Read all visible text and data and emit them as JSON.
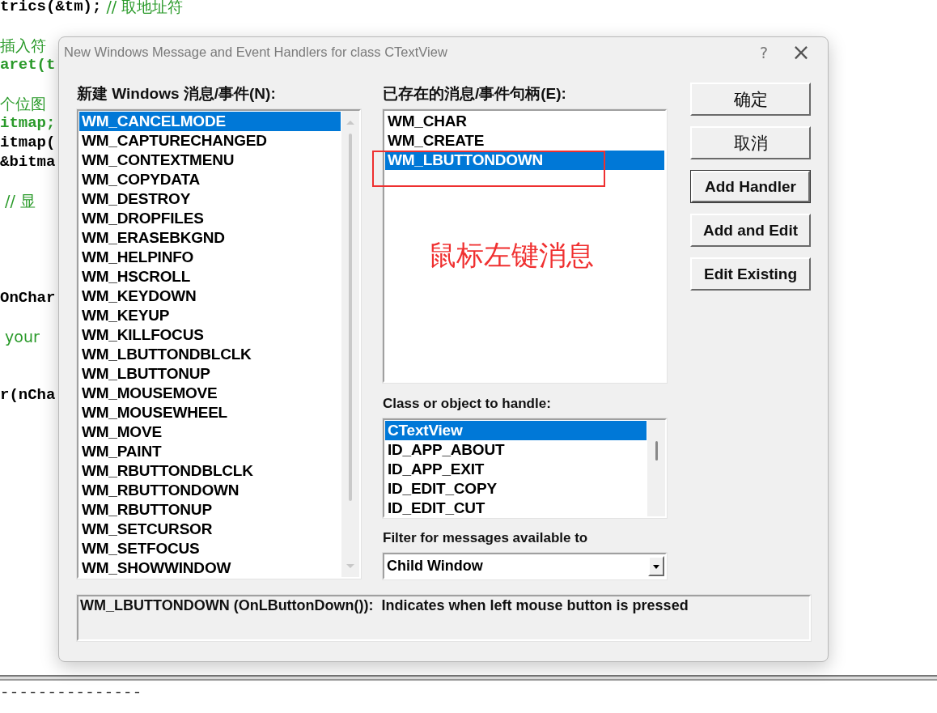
{
  "editor": {
    "lines": [
      {
        "segments": [
          {
            "text": "trics(&tm);",
            "kind": "code"
          },
          {
            "text": " // 取地址符",
            "kind": "comment"
          }
        ]
      },
      {
        "segments": [
          {
            "text": "插入符",
            "kind": "comment"
          }
        ]
      },
      {
        "segments": [
          {
            "text": "aret(t",
            "kind": "keyword"
          }
        ]
      },
      {
        "segments": [
          {
            "text": "个位图",
            "kind": "comment"
          }
        ]
      },
      {
        "segments": [
          {
            "text": "itmap;",
            "kind": "keyword"
          }
        ]
      },
      {
        "segments": [
          {
            "text": "itmap(",
            "kind": "code"
          }
        ]
      },
      {
        "segments": [
          {
            "text": "&bitma",
            "kind": "code"
          }
        ]
      },
      {
        "segments": [
          {
            "text": " // 显",
            "kind": "comment"
          }
        ]
      },
      {
        "segments": [
          {
            "text": "OnChar",
            "kind": "code"
          }
        ]
      },
      {
        "segments": [
          {
            "text": " your",
            "kind": "comment"
          }
        ]
      },
      {
        "segments": [
          {
            "text": "r(nCha",
            "kind": "code"
          }
        ]
      }
    ]
  },
  "dialog": {
    "title": "New Windows Message and Event Handlers for class CTextView",
    "help_button": "?",
    "close_button": "×",
    "new_messages": {
      "label": "新建 Windows 消息/事件(N):",
      "items": [
        {
          "text": "WM_CANCELMODE",
          "selected": true
        },
        {
          "text": "WM_CAPTURECHANGED",
          "selected": false
        },
        {
          "text": "WM_CONTEXTMENU",
          "selected": false
        },
        {
          "text": "WM_COPYDATA",
          "selected": false
        },
        {
          "text": "WM_DESTROY",
          "selected": false
        },
        {
          "text": "WM_DROPFILES",
          "selected": false
        },
        {
          "text": "WM_ERASEBKGND",
          "selected": false
        },
        {
          "text": "WM_HELPINFO",
          "selected": false
        },
        {
          "text": "WM_HSCROLL",
          "selected": false
        },
        {
          "text": "WM_KEYDOWN",
          "selected": false
        },
        {
          "text": "WM_KEYUP",
          "selected": false
        },
        {
          "text": "WM_KILLFOCUS",
          "selected": false
        },
        {
          "text": "WM_LBUTTONDBLCLK",
          "selected": false
        },
        {
          "text": "WM_LBUTTONUP",
          "selected": false
        },
        {
          "text": "WM_MOUSEMOVE",
          "selected": false
        },
        {
          "text": "WM_MOUSEWHEEL",
          "selected": false
        },
        {
          "text": "WM_MOVE",
          "selected": false
        },
        {
          "text": "WM_PAINT",
          "selected": false
        },
        {
          "text": "WM_RBUTTONDBLCLK",
          "selected": false
        },
        {
          "text": "WM_RBUTTONDOWN",
          "selected": false
        },
        {
          "text": "WM_RBUTTONUP",
          "selected": false
        },
        {
          "text": "WM_SETCURSOR",
          "selected": false
        },
        {
          "text": "WM_SETFOCUS",
          "selected": false
        },
        {
          "text": "WM_SHOWWINDOW",
          "selected": false
        }
      ]
    },
    "existing_handlers": {
      "label": "已存在的消息/事件句柄(E):",
      "items": [
        {
          "text": "WM_CHAR",
          "selected": false
        },
        {
          "text": "WM_CREATE",
          "selected": false
        },
        {
          "text": "WM_LBUTTONDOWN",
          "selected": true
        }
      ]
    },
    "annotation": {
      "text": "鼠标左键消息"
    },
    "buttons": [
      {
        "label": "确定",
        "default": false
      },
      {
        "label": "取消",
        "default": false
      },
      {
        "label": "Add Handler",
        "default": true
      },
      {
        "label": "Add and Edit",
        "default": false
      },
      {
        "label": "Edit Existing",
        "default": false
      }
    ],
    "class_list": {
      "label": "Class or object to handle:",
      "items": [
        {
          "text": "CTextView",
          "selected": true
        },
        {
          "text": "ID_APP_ABOUT",
          "selected": false
        },
        {
          "text": "ID_APP_EXIT",
          "selected": false
        },
        {
          "text": "ID_EDIT_COPY",
          "selected": false
        },
        {
          "text": "ID_EDIT_CUT",
          "selected": false
        }
      ]
    },
    "filter": {
      "label": "Filter for messages available to",
      "value": "Child Window"
    },
    "description": "WM_LBUTTONDOWN (OnLButtonDown()):  Indicates when left mouse button is pressed"
  },
  "output_divider": "---------------"
}
